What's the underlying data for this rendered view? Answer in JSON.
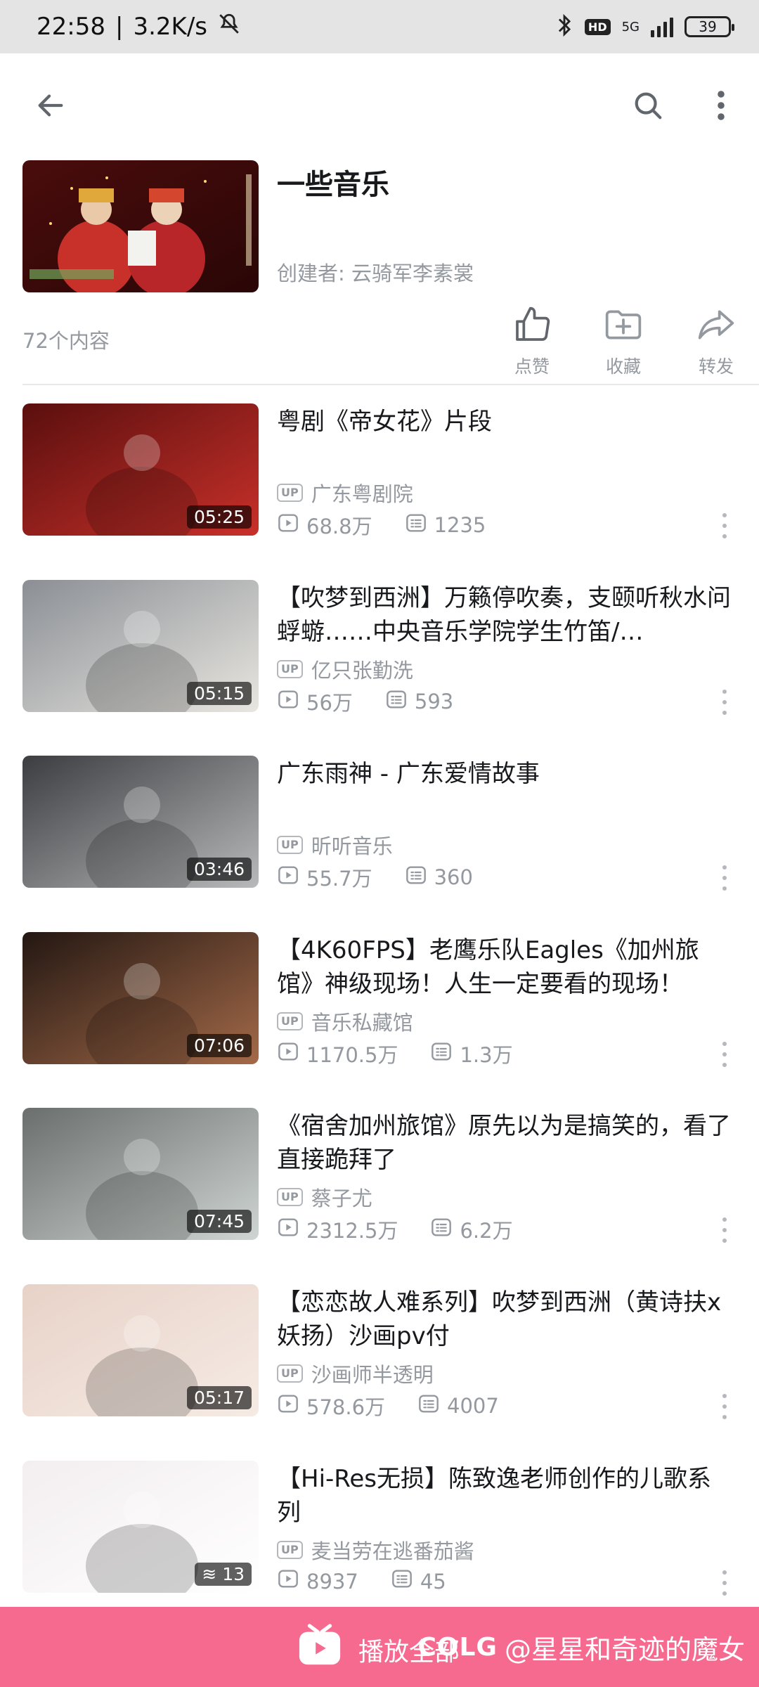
{
  "status_bar": {
    "time": "22:58",
    "speed": "3.2K/s",
    "network": "5G",
    "hd": "HD",
    "battery": "39"
  },
  "icons": {
    "back": "arrow-left-icon",
    "search": "search-icon",
    "more": "more-vertical-icon"
  },
  "playlist": {
    "title": "一些音乐",
    "creator": "创建者: 云骑军李素裳",
    "count": "72个内容",
    "actions": [
      {
        "label": "点赞",
        "icon": "thumb-up-icon"
      },
      {
        "label": "收藏",
        "icon": "folder-add-icon"
      },
      {
        "label": "转发",
        "icon": "share-icon"
      }
    ]
  },
  "items": [
    {
      "title": "粤剧《帝女花》片段",
      "uploader": "广东粤剧院",
      "plays": "68.8万",
      "danmaku": "1235",
      "duration": "05:25",
      "thumb_colors": [
        "#5a0f0e",
        "#c8302a"
      ]
    },
    {
      "title": "【吹梦到西洲】万籁停吹奏，支颐听秋水问蜉蝣……中央音乐学院学生竹笛/…",
      "uploader": "亿只张勤洗",
      "plays": "56万",
      "danmaku": "593",
      "duration": "05:15",
      "thumb_colors": [
        "#8b8f95",
        "#e8e6e0"
      ]
    },
    {
      "title": "广东雨神 - 广东爱情故事",
      "uploader": "昕听音乐",
      "plays": "55.7万",
      "danmaku": "360",
      "duration": "03:46",
      "thumb_colors": [
        "#3b3d40",
        "#b7b9bb"
      ]
    },
    {
      "title": "【4K60FPS】老鹰乐队Eagles《加州旅馆》神级现场！人生一定要看的现场！",
      "uploader": "音乐私藏馆",
      "plays": "1170.5万",
      "danmaku": "1.3万",
      "duration": "07:06",
      "thumb_colors": [
        "#231712",
        "#a46a49"
      ]
    },
    {
      "title": "《宿舍加州旅馆》原先以为是搞笑的，看了直接跪拜了",
      "uploader": "蔡子尤",
      "plays": "2312.5万",
      "danmaku": "6.2万",
      "duration": "07:45",
      "thumb_colors": [
        "#6a6f6e",
        "#cfd5d2"
      ]
    },
    {
      "title": "【恋恋故人难系列】吹梦到西洲（黄诗扶x妖扬）沙画pv付",
      "uploader": "沙画师半透明",
      "plays": "578.6万",
      "danmaku": "4007",
      "duration": "05:17",
      "thumb_colors": [
        "#e8d2c8",
        "#f5ebe4"
      ]
    },
    {
      "title": "【Hi-Res无损】陈致逸老师创作的儿歌系列",
      "uploader": "麦当劳在逃番茄酱",
      "plays": "8937",
      "danmaku": "45",
      "duration": "13",
      "thumb_colors": [
        "#f3eef0",
        "#ffffff"
      ]
    }
  ],
  "bottom_bar": {
    "play_all": "播放全部",
    "watermark_logo": "COLG",
    "watermark_user": "@星星和奇迹的魔女",
    "color": "#f66a8f"
  }
}
